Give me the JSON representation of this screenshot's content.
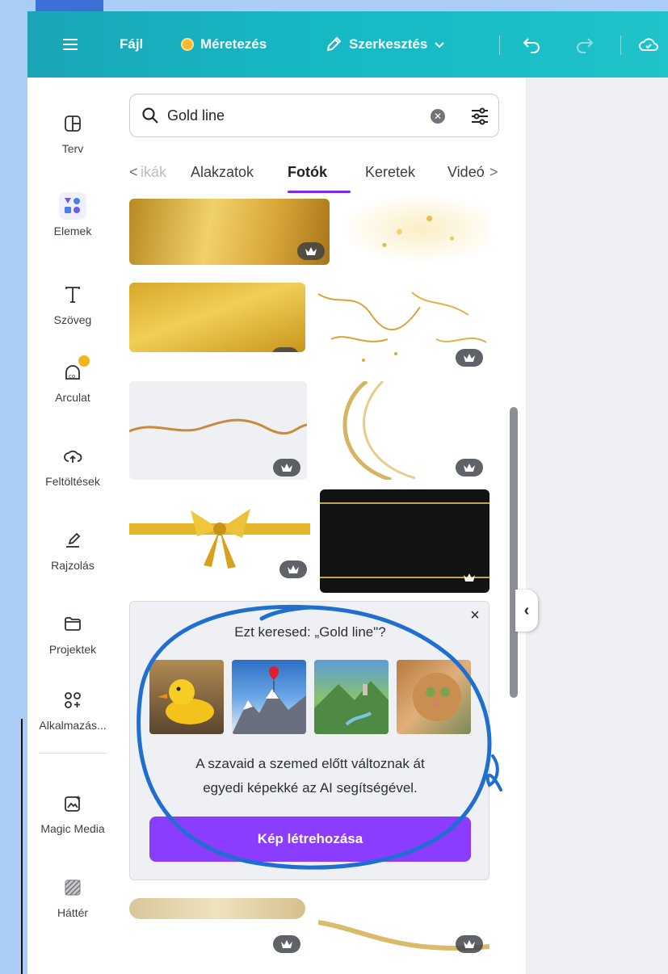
{
  "toolbar": {
    "menu_icon": "hamburger-icon",
    "file": "Fájl",
    "resize": "Méretezés",
    "edit": "Szerkesztés",
    "undo_icon": "undo-icon",
    "redo_icon": "redo-icon",
    "save_icon": "cloud-check-icon"
  },
  "sidebar": {
    "items": [
      {
        "label": "Terv",
        "icon": "layout-icon"
      },
      {
        "label": "Elemek",
        "icon": "shapes-icon"
      },
      {
        "label": "Szöveg",
        "icon": "text-icon"
      },
      {
        "label": "Arculat",
        "icon": "brand-icon"
      },
      {
        "label": "Feltöltések",
        "icon": "upload-cloud-icon"
      },
      {
        "label": "Rajzolás",
        "icon": "draw-pen-icon"
      },
      {
        "label": "Projektek",
        "icon": "folder-icon"
      },
      {
        "label": "Alkalmazás...",
        "icon": "apps-icon"
      },
      {
        "label": "Magic Media",
        "icon": "magic-media-icon"
      },
      {
        "label": "Háttér",
        "icon": "background-pattern-icon"
      }
    ]
  },
  "search": {
    "value": "Gold line",
    "clear_icon": "clear-icon",
    "filter_icon": "filter-sliders-icon"
  },
  "tabs": {
    "prev": "<",
    "items": [
      "ikák",
      "Alakzatok",
      "Fotók",
      "Keretek",
      "Videó"
    ],
    "active": "Fotók",
    "next": ">"
  },
  "promo": {
    "question": "Ezt keresed: „Gold line\"?",
    "description_line1": "A szavaid a szemed előtt változnak át",
    "description_line2": "egyedi képekké az AI segítségével.",
    "cta": "Kép létrehozása",
    "close": "×",
    "images": [
      "rubber-duck",
      "mountains-heart-balloon",
      "green-valley-castle",
      "cat-painting"
    ]
  },
  "collapse": "‹",
  "colors": {
    "toolbar_start": "#1aa6b7",
    "toolbar_end": "#1fc3c9",
    "accent": "#8b3dff",
    "tab_underline": "#7d2ae8",
    "annotation": "#1f6fd1"
  }
}
